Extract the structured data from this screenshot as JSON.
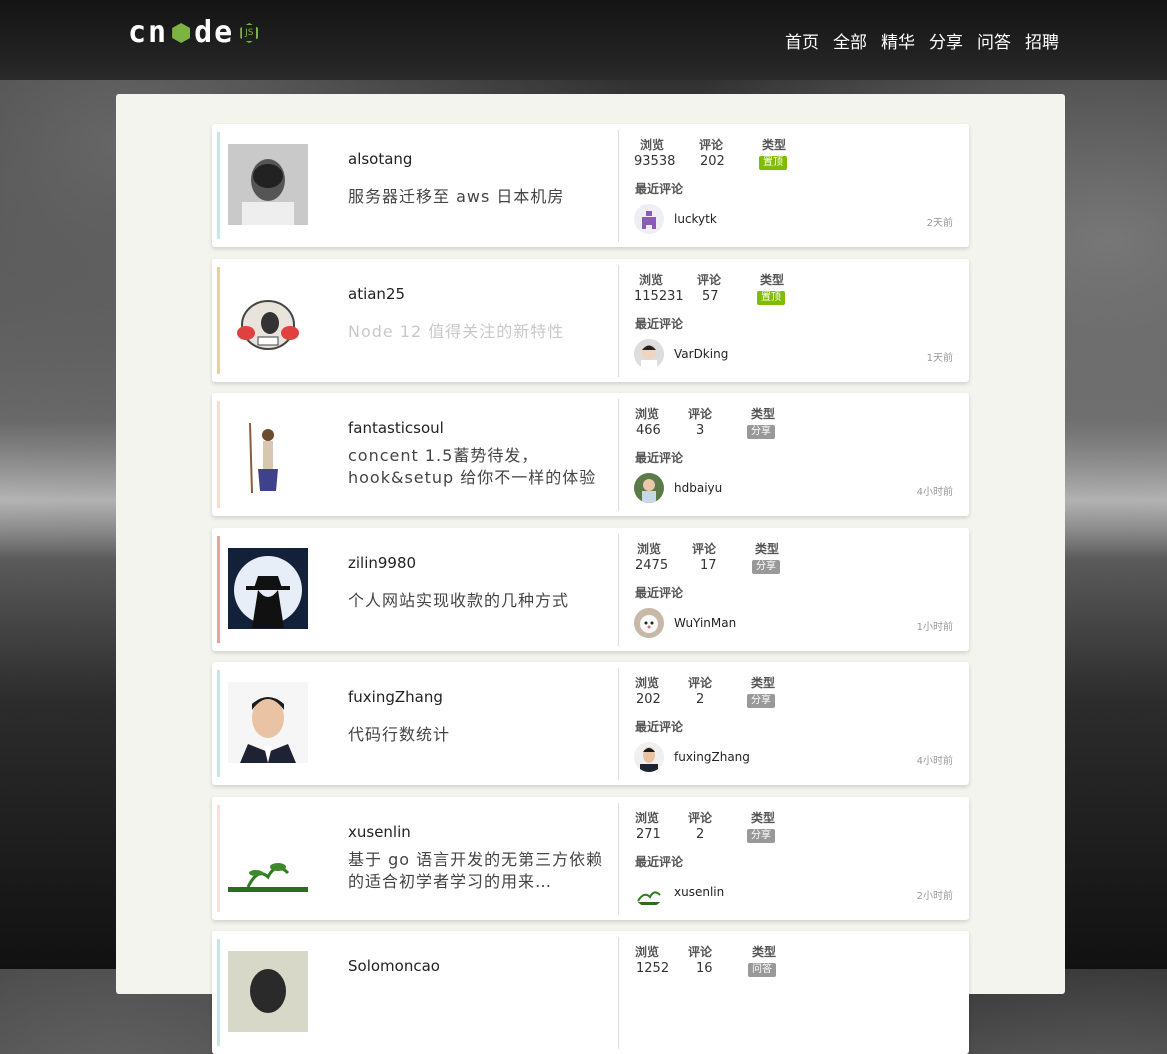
{
  "header": {
    "logo_text_left": "cn",
    "logo_text_right": "de",
    "logo_badge": "JS",
    "nav": [
      "首页",
      "全部",
      "精华",
      "分享",
      "问答",
      "招聘"
    ]
  },
  "labels": {
    "views": "浏览",
    "replies": "评论",
    "type": "类型",
    "recent": "最近评论"
  },
  "colors": {
    "accent": "#80bd01",
    "stripes": [
      "#c7e6e6",
      "#e6d48f",
      "#f6ddd0",
      "#e8a494",
      "#c7e6e6",
      "#f7e0e0",
      "#c7e6e6"
    ]
  },
  "topics": [
    {
      "author": "alsotang",
      "title": "服务器迁移至 aws 日本机房",
      "views": "93538",
      "replies": "202",
      "type": "置顶",
      "recent_user": "luckytk",
      "recent_time": "2天前"
    },
    {
      "author": "atian25",
      "title": "Node 12 值得关注的新特性",
      "views": "115231",
      "replies": "57",
      "type": "置顶",
      "recent_user": "VarDking",
      "recent_time": "1天前"
    },
    {
      "author": "fantasticsoul",
      "title": "concent 1.5蓄势待发， hook&setup 给你不一样的体验",
      "views": "466",
      "replies": "3",
      "type": "分享",
      "recent_user": "hdbaiyu",
      "recent_time": "4小时前"
    },
    {
      "author": "zilin9980",
      "title": "个人网站实现收款的几种方式",
      "views": "2475",
      "replies": "17",
      "type": "分享",
      "recent_user": "WuYinMan",
      "recent_time": "1小时前"
    },
    {
      "author": "fuxingZhang",
      "title": "代码行数统计",
      "views": "202",
      "replies": "2",
      "type": "分享",
      "recent_user": "fuxingZhang",
      "recent_time": "4小时前"
    },
    {
      "author": "xusenlin",
      "title": "基于 go 语言开发的无第三方依赖的适合初学者学习的用来…",
      "views": "271",
      "replies": "2",
      "type": "分享",
      "recent_user": "xusenlin",
      "recent_time": "2小时前"
    },
    {
      "author": "Solomoncao",
      "title": "",
      "views": "1252",
      "replies": "16",
      "type": "问答",
      "recent_user": "",
      "recent_time": ""
    }
  ]
}
